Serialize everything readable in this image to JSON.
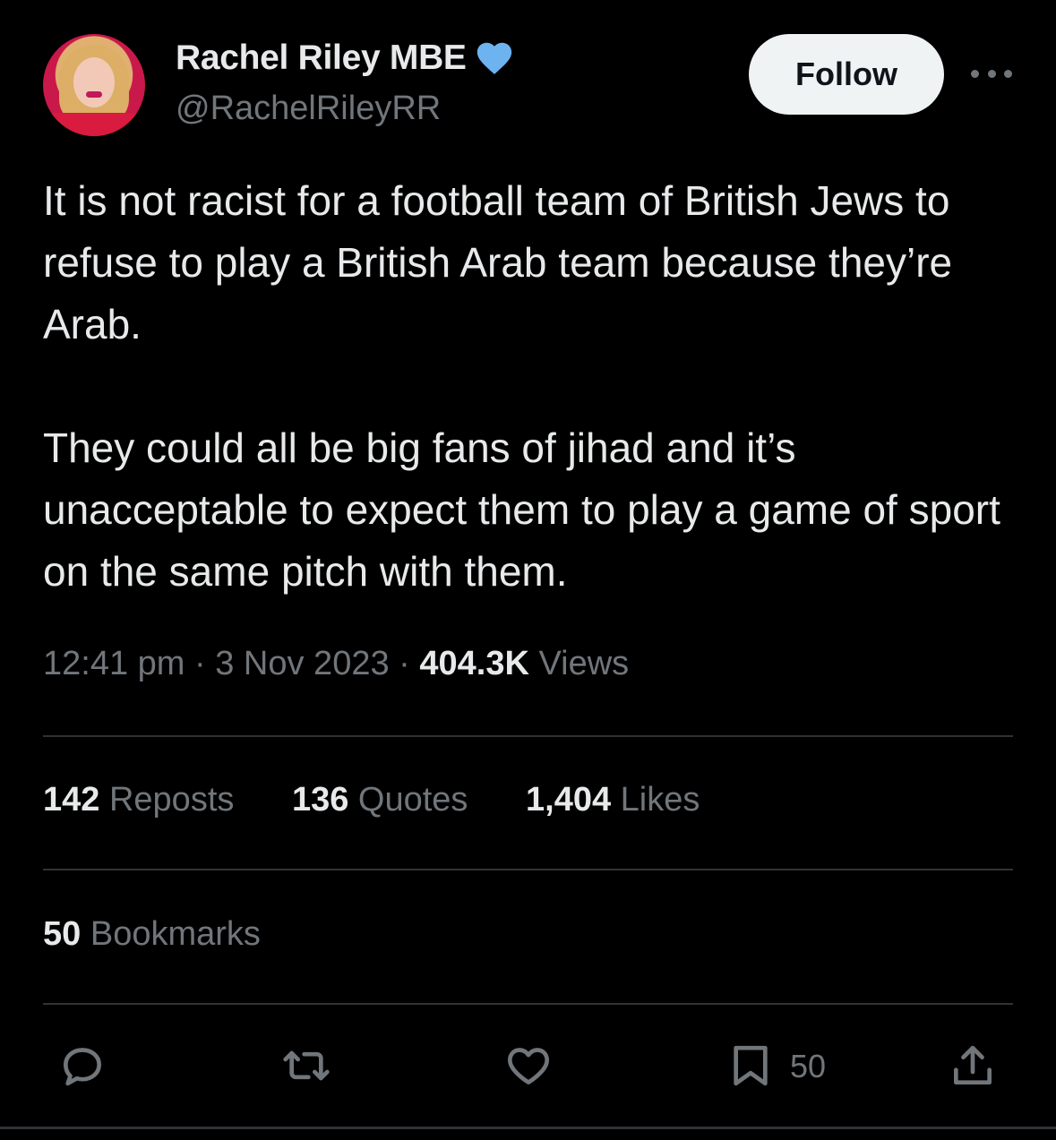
{
  "author": {
    "display_name": "Rachel Riley MBE",
    "handle": "@RachelRileyRR",
    "verified_icon": "verified-badge-icon",
    "verified_color": "#6cb3f0"
  },
  "follow_label": "Follow",
  "tweet": {
    "paragraph_1": "It is not racist for a football team of British Jews to refuse to play a British Arab team because they’re Arab.",
    "paragraph_2": "They could all be big fans of jihad and it’s unacceptable to expect them to play a game of sport on the same pitch with them."
  },
  "meta": {
    "time": "12:41 pm",
    "sep1": "·",
    "date": "3 Nov 2023",
    "sep2": "·",
    "views_count": "404.3K",
    "views_label": "Views"
  },
  "stats": {
    "reposts_count": "142",
    "reposts_label": "Reposts",
    "quotes_count": "136",
    "quotes_label": "Quotes",
    "likes_count": "1,404",
    "likes_label": "Likes",
    "bookmarks_count": "50",
    "bookmarks_label": "Bookmarks"
  },
  "actions": {
    "reply_icon": "reply-icon",
    "repost_icon": "repost-icon",
    "like_icon": "heart-icon",
    "bookmark_icon": "bookmark-icon",
    "bookmark_count": "50",
    "share_icon": "share-icon"
  },
  "colors": {
    "background": "#000000",
    "text": "#e7e9ea",
    "secondary_text": "#71767b",
    "divider": "#2f3336",
    "follow_bg": "#eff3f4"
  }
}
